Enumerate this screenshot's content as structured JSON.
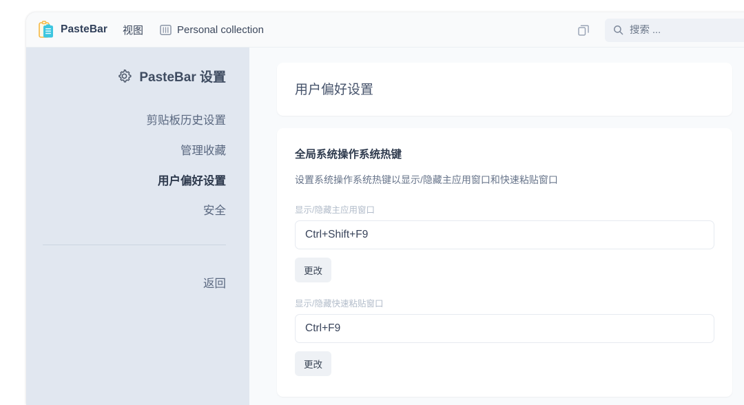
{
  "topbar": {
    "brand_icon": "clipboard-icon",
    "brand_name": "PasteBar",
    "menu_view": "视图",
    "collection_icon": "board-columns-icon",
    "collection_name": "Personal collection",
    "panel_icon": "copy-panels-icon",
    "search_icon": "search-icon",
    "search_placeholder": "搜索 ...",
    "search_value": "",
    "search_shortcut": "/"
  },
  "sidebar": {
    "heading_icon": "gear-icon",
    "heading": "PasteBar 设置",
    "items": [
      {
        "label": "剪贴板历史设置",
        "active": false
      },
      {
        "label": "管理收藏",
        "active": false
      },
      {
        "label": "用户偏好设置",
        "active": true
      },
      {
        "label": "安全",
        "active": false
      }
    ],
    "back_label": "返回"
  },
  "main": {
    "page_title": "用户偏好设置",
    "section_title": "全局系统操作系统热键",
    "section_desc": "设置系统操作系统热键以显示/隐藏主应用窗口和快速粘贴窗口",
    "fields": [
      {
        "label": "显示/隐藏主应用窗口",
        "value": "Ctrl+Shift+F9",
        "button_label": "更改"
      },
      {
        "label": "显示/隐藏快速粘贴窗口",
        "value": "Ctrl+F9",
        "button_label": "更改"
      }
    ]
  },
  "colors": {
    "sidebar_bg": "#e1e7f0",
    "card_bg": "#ffffff",
    "accent_text": "#2e3a4d",
    "muted_text": "#67748a",
    "logo_yellow": "#f5b841",
    "logo_cyan": "#3ec6e0"
  }
}
